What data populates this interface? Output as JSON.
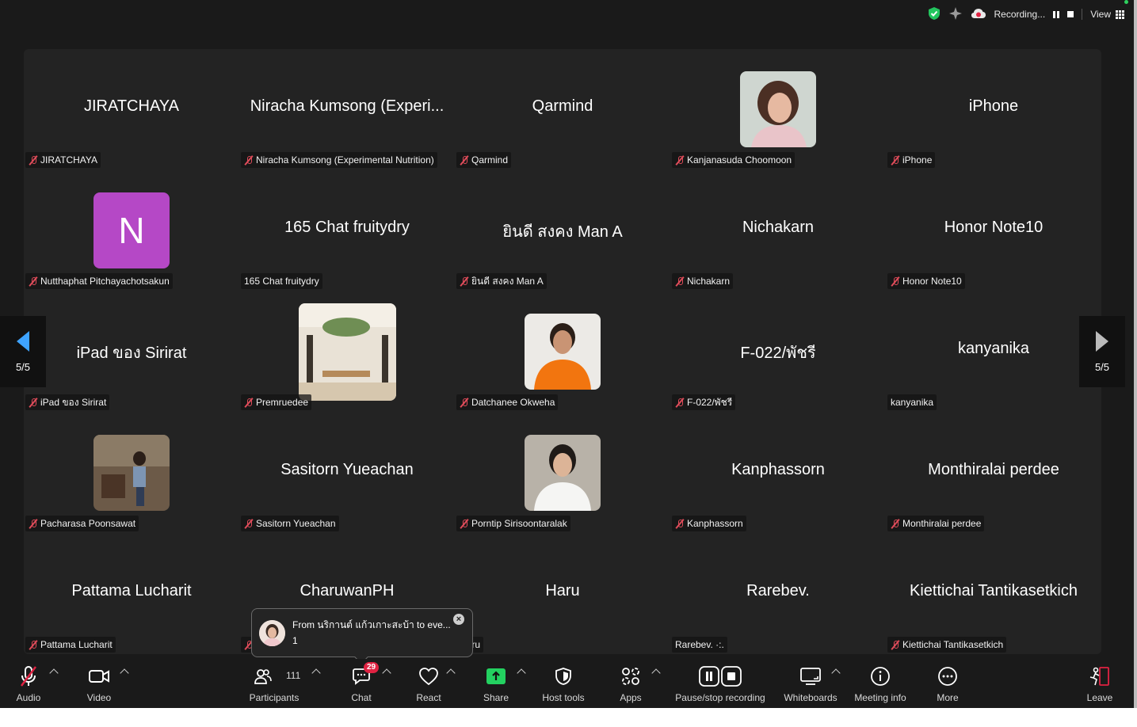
{
  "topbar": {
    "recording_label": "Recording...",
    "view_label": "View",
    "icons": [
      "shield-check-icon",
      "sparkle-icon",
      "cloud-recording-icon",
      "pause-icon",
      "stop-icon",
      "grid-view-icon"
    ]
  },
  "tiles": [
    {
      "big": "JIRATCHAYA",
      "name": "JIRATCHAYA",
      "muted": true
    },
    {
      "big": "Niracha Kumsong (Experi...",
      "name": "Niracha Kumsong (Experimental Nutrition)",
      "muted": true
    },
    {
      "big": "Qarmind",
      "name": "Qarmind",
      "muted": true
    },
    {
      "big": "",
      "name": "Kanjanasuda Choomoon",
      "muted": true,
      "avatar": "photo-woman"
    },
    {
      "big": "iPhone",
      "name": "iPhone",
      "muted": true
    },
    {
      "big": "",
      "name": "Nutthaphat Pitchayachotsakun",
      "muted": true,
      "avatar_letter": "N"
    },
    {
      "big": "165 Chat fruitydry",
      "name": "165 Chat fruitydry",
      "muted": false
    },
    {
      "big": "ยินดี สงคง Man A",
      "name": "ยินดี สงคง Man A",
      "muted": true
    },
    {
      "big": "Nichakarn",
      "name": "Nichakarn",
      "muted": true
    },
    {
      "big": "Honor Note10",
      "name": "Honor Note10",
      "muted": true
    },
    {
      "big": "iPad ของ Sirirat",
      "name": "iPad ของ Sirirat",
      "muted": true
    },
    {
      "big": "",
      "name": "Premruedee",
      "muted": true,
      "avatar": "photo-cafe"
    },
    {
      "big": "",
      "name": "Datchanee Okweha",
      "muted": true,
      "avatar": "photo-orange"
    },
    {
      "big": "F-022/พัชรี",
      "name": "F-022/พัชรี",
      "muted": true
    },
    {
      "big": "kanyanika",
      "name": "kanyanika",
      "muted": false
    },
    {
      "big": "",
      "name": "Pacharasa  Poonsawat",
      "muted": true,
      "avatar": "photo-outdoor"
    },
    {
      "big": "Sasitorn Yueachan",
      "name": "Sasitorn Yueachan",
      "muted": true
    },
    {
      "big": "",
      "name": "Porntip Sirisoontaralak",
      "muted": true,
      "avatar": "photo-white"
    },
    {
      "big": "Kanphassorn",
      "name": "Kanphassorn",
      "muted": true
    },
    {
      "big": "Monthiralai perdee",
      "name": "Monthiralai perdee",
      "muted": true
    },
    {
      "big": "Pattama Lucharit",
      "name": "Pattama Lucharit",
      "muted": true
    },
    {
      "big": "CharuwanPH",
      "name": "",
      "muted": true
    },
    {
      "big": "Haru",
      "name": "Haru",
      "muted": false
    },
    {
      "big": "Rarebev.",
      "name": "Rarebev.  ·:.",
      "muted": false
    },
    {
      "big": "Kiettichai Tantikasetkich",
      "name": "Kiettichai Tantikasetkich",
      "muted": true
    }
  ],
  "pager": {
    "left_label": "5/5",
    "right_label": "5/5"
  },
  "toast": {
    "from": "From นริกานต์ แก้วเกาะสะบ้า to eve...",
    "message": "1"
  },
  "toolbar": {
    "audio": "Audio",
    "video": "Video",
    "participants": "Participants",
    "participants_count": "111",
    "chat": "Chat",
    "chat_badge": "29",
    "react": "React",
    "share": "Share",
    "host_tools": "Host tools",
    "apps": "Apps",
    "pause_stop": "Pause/stop recording",
    "whiteboards": "Whiteboards",
    "meeting_info": "Meeting info",
    "more": "More",
    "leave": "Leave"
  },
  "colors": {
    "share_green": "#23d160",
    "muted_red": "#e04c5a",
    "badge_red": "#e02242",
    "letter_avatar": "#b548c6",
    "pager_arrow": "#3ea3ff"
  }
}
